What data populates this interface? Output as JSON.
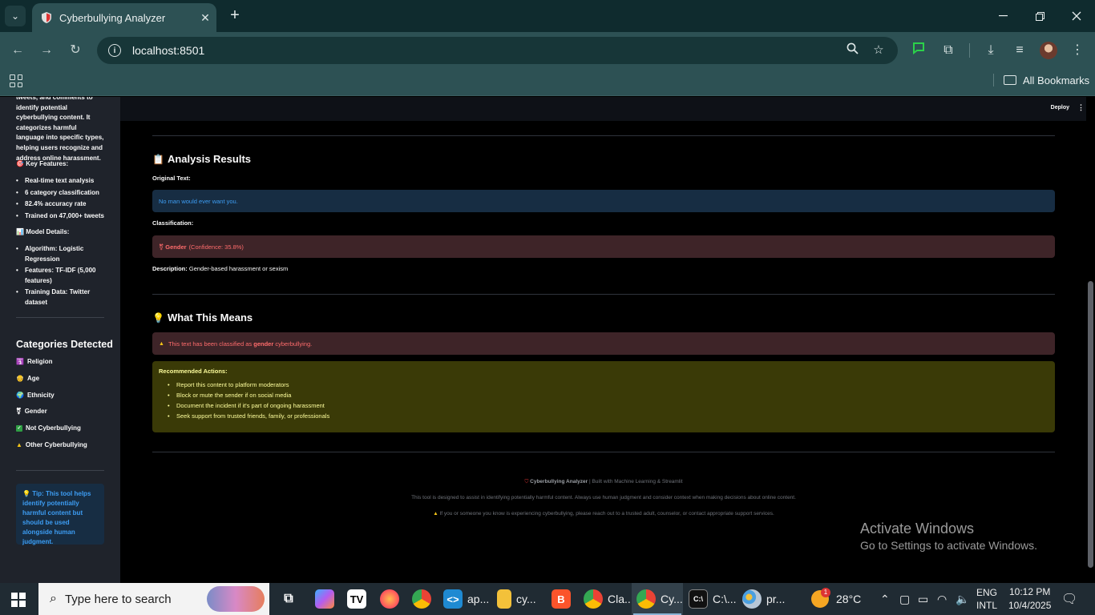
{
  "browser": {
    "tab_title": "Cyberbullying Analyzer",
    "url": "localhost:8501",
    "all_bookmarks": "All Bookmarks"
  },
  "sidebar": {
    "intro": "tweets, and comments to identify potential cyberbullying content. It categorizes harmful language into specific types, helping users recognize and address online harassment.",
    "features_title": "Key Features:",
    "features_icon": "target-icon",
    "features": [
      "Real-time text analysis",
      "6 category classification",
      "82.4% accuracy rate",
      "Trained on 47,000+ tweets"
    ],
    "model_title": "Model Details:",
    "model_icon": "bar-chart-icon",
    "model": [
      "Algorithm: Logistic Regression",
      "Features: TF-IDF (5,000 features)",
      "Training Data: Twitter dataset"
    ],
    "categories_title": "Categories Detected",
    "categories": [
      {
        "icon": "place-of-worship-icon",
        "label": "Religion"
      },
      {
        "icon": "older-face-icon",
        "label": "Age"
      },
      {
        "icon": "globe-icon",
        "label": "Ethnicity"
      },
      {
        "icon": "gender-icon",
        "label": "Gender"
      },
      {
        "icon": "check-icon",
        "label": "Not Cyberbullying"
      },
      {
        "icon": "warning-icon",
        "label": "Other Cyberbullying"
      }
    ],
    "tip": "Tip: This tool helps identify potentially harmful content but should be used alongside human judgment."
  },
  "header": {
    "deploy": "Deploy",
    "menu": "⋮"
  },
  "results": {
    "title": "Analysis Results",
    "title_icon": "clipboard-icon",
    "original_label": "Original Text:",
    "original_text": "No man would ever want you.",
    "classification_label": "Classification:",
    "classification_name": "Gender",
    "classification_conf": "(Confidence: 35.8%)",
    "description_label": "Description:",
    "description_text": "Gender-based harassment or sexism"
  },
  "meaning": {
    "title": "What This Means",
    "title_icon": "lightbulb-icon",
    "alert_pre": "This text has been classified as",
    "alert_category": "gender",
    "alert_post": "cyberbullying.",
    "actions_title": "Recommended Actions:",
    "actions": [
      "Report this content to platform moderators",
      "Block or mute the sender if on social media",
      "Document the incident if it's part of ongoing harassment",
      "Seek support from trusted friends, family, or professionals"
    ]
  },
  "footer": {
    "brand": "Cyberbullying Analyzer",
    "built": "| Built with Machine Learning & Streamlit",
    "disclaimer": "This tool is designed to assist in identifying potentially harmful content. Always use human judgment and consider context when making decisions about online content.",
    "help": "If you or someone you know is experiencing cyberbullying, please reach out to a trusted adult, counselor, or contact appropriate support services."
  },
  "watermark": {
    "line1": "Activate Windows",
    "line2": "Go to Settings to activate Windows."
  },
  "taskbar": {
    "search_placeholder": "Type here to search",
    "apps": [
      {
        "icon": "vscode-icon",
        "label": "ap..."
      },
      {
        "icon": "folder-icon",
        "label": "cy..."
      },
      {
        "icon": "chrome-icon",
        "label": "Cla..."
      },
      {
        "icon": "chrome-icon",
        "label": "Cy..."
      },
      {
        "icon": "terminal-icon",
        "label": "C:\\..."
      },
      {
        "icon": "paint-icon",
        "label": "pr..."
      }
    ],
    "weather": "28°C",
    "weather_badge": "1",
    "lang_top": "ENG",
    "lang_bottom": "INTL",
    "time": "10:12 PM",
    "date": "10/4/2025"
  }
}
